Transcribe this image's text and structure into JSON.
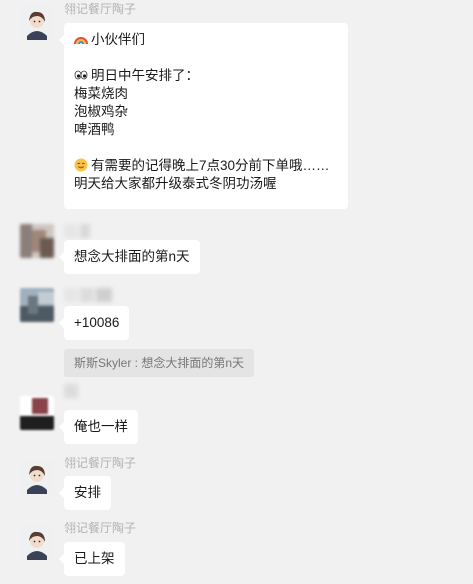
{
  "messages": [
    {
      "sender": "翎记餐厅陶子",
      "lines": [
        "小伙伴们",
        "",
        "明日中午安排了：",
        "梅菜烧肉",
        "泡椒鸡杂",
        "啤酒鸭",
        "",
        "有需要的记得晚上7点30分前下单哦……",
        "明天给大家都升级泰式冬阴功汤喔"
      ],
      "icons": [
        "rainbow-emoji",
        "eyes-emoji",
        "smile-emoji"
      ]
    },
    {
      "sender": "",
      "text": "想念大排面的第n天"
    },
    {
      "sender": "",
      "text": "+10086"
    },
    {
      "quote": "斯斯Skyler : 想念大排面的第n天"
    },
    {
      "sender": "",
      "text": "俺也一样"
    },
    {
      "sender": "翎记餐厅陶子",
      "text": "安排"
    },
    {
      "sender": "翎记餐厅陶子",
      "text": "已上架"
    }
  ]
}
